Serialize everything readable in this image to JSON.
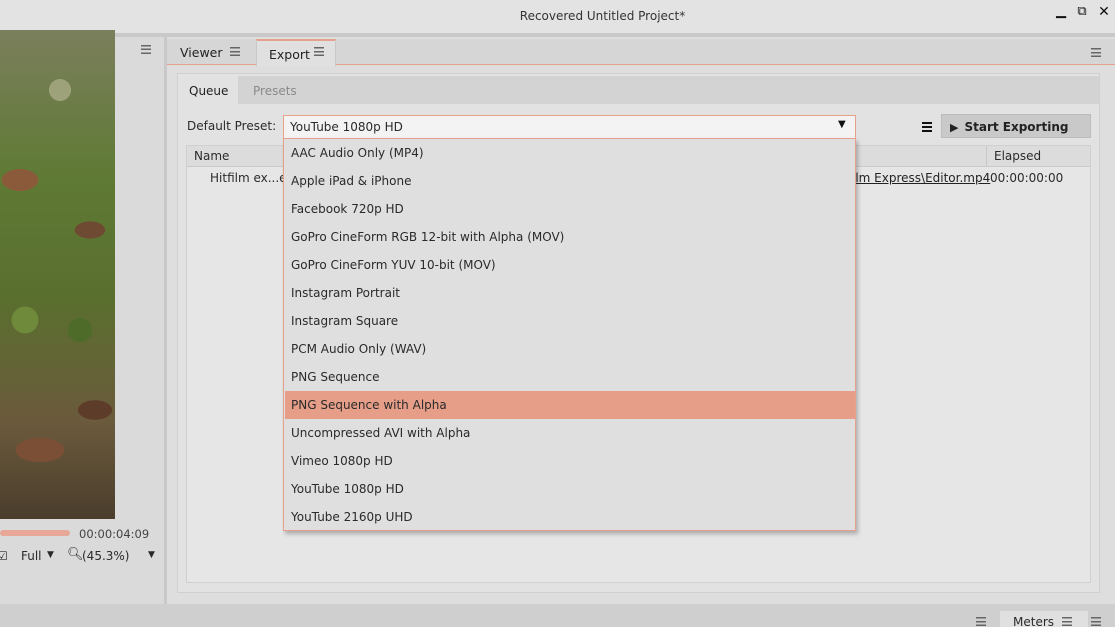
{
  "window": {
    "title": "Recovered Untitled Project*",
    "minimize_glyph": "▁",
    "restore_glyph": "⧉",
    "close_glyph": "✕"
  },
  "left_viewer": {
    "timecode": "00:00:04:09",
    "quality": "Full",
    "zoom": "(45.3%)"
  },
  "tabs": [
    "Viewer",
    "Export"
  ],
  "export": {
    "subtabs": [
      "Queue",
      "Presets"
    ],
    "default_preset_label": "Default Preset:",
    "default_preset_value": "YouTube 1080p HD",
    "start_button": "Start Exporting",
    "table": {
      "col_name": "Name",
      "col_elapsed": "Elapsed",
      "row_name": "Hitfilm ex...es",
      "row_path": "ilm Express\\Editor.mp4",
      "row_elapsed": "00:00:00:00"
    },
    "dropdown_options": [
      "AAC Audio Only (MP4)",
      "Apple iPad & iPhone",
      "Facebook 720p HD",
      "GoPro CineForm RGB 12-bit with Alpha (MOV)",
      "GoPro CineForm YUV 10-bit (MOV)",
      "Instagram Portrait",
      "Instagram Square",
      "PCM Audio Only (WAV)",
      "PNG Sequence",
      "PNG Sequence with Alpha",
      "Uncompressed AVI with Alpha",
      "Vimeo 1080p HD",
      "YouTube 1080p HD",
      "YouTube 2160p UHD"
    ],
    "highlighted_option": "PNG Sequence with Alpha"
  },
  "bottom": {
    "meters_tab": "Meters"
  },
  "colors": {
    "accent": "#e69e88",
    "panel_bg": "#dedede"
  }
}
